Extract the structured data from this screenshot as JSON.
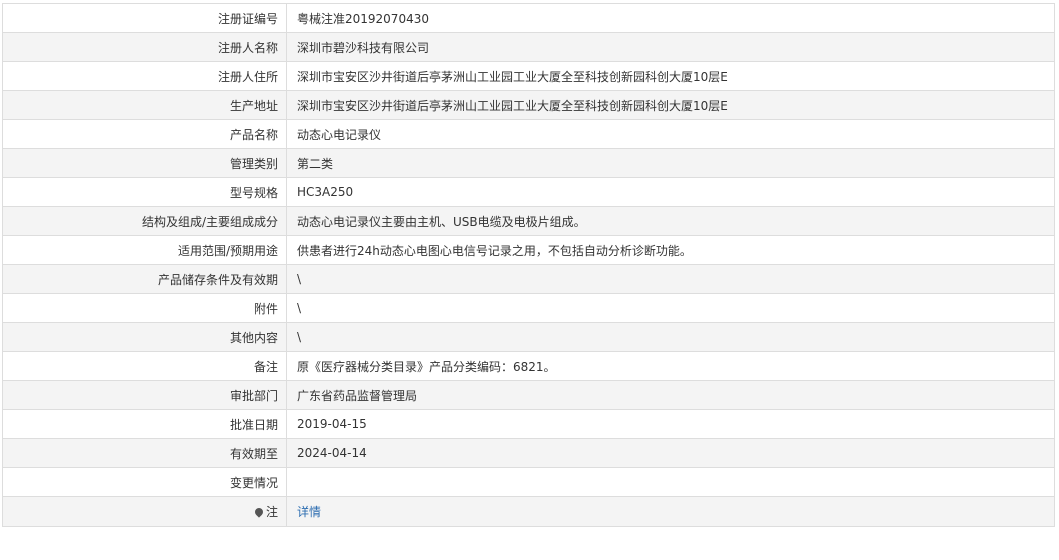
{
  "rows": [
    {
      "label": "注册证编号",
      "value": "粤械注准20192070430"
    },
    {
      "label": "注册人名称",
      "value": "深圳市碧沙科技有限公司"
    },
    {
      "label": "注册人住所",
      "value": "深圳市宝安区沙井街道后亭茅洲山工业园工业大厦全至科技创新园科创大厦10层E"
    },
    {
      "label": "生产地址",
      "value": "深圳市宝安区沙井街道后亭茅洲山工业园工业大厦全至科技创新园科创大厦10层E"
    },
    {
      "label": "产品名称",
      "value": "动态心电记录仪"
    },
    {
      "label": "管理类别",
      "value": "第二类"
    },
    {
      "label": "型号规格",
      "value": "HC3A250"
    },
    {
      "label": "结构及组成/主要组成成分",
      "value": "动态心电记录仪主要由主机、USB电缆及电极片组成。"
    },
    {
      "label": "适用范围/预期用途",
      "value": "供患者进行24h动态心电图心电信号记录之用，不包括自动分析诊断功能。"
    },
    {
      "label": "产品储存条件及有效期",
      "value": "\\"
    },
    {
      "label": "附件",
      "value": "\\"
    },
    {
      "label": "其他内容",
      "value": "\\"
    },
    {
      "label": "备注",
      "value": "原《医疗器械分类目录》产品分类编码：6821。"
    },
    {
      "label": "审批部门",
      "value": "广东省药品监督管理局"
    },
    {
      "label": "批准日期",
      "value": "2019-04-15"
    },
    {
      "label": "有效期至",
      "value": "2024-04-14"
    },
    {
      "label": "变更情况",
      "value": ""
    }
  ],
  "note": {
    "icon": "pin-icon",
    "label": "注",
    "link_text": "详情"
  },
  "colors": {
    "border": "#dddddd",
    "stripe": "#f4f4f4",
    "text": "#333333",
    "link": "#2b6cb0"
  }
}
